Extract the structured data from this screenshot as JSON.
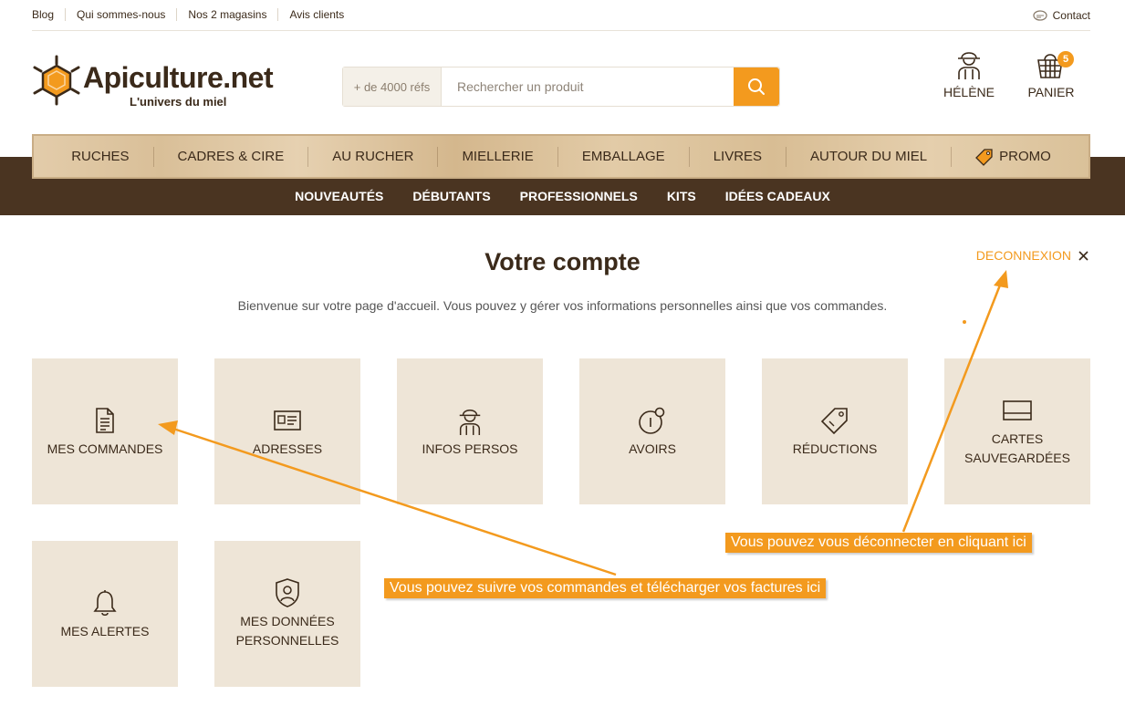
{
  "topbar": {
    "links": [
      "Blog",
      "Qui sommes-nous",
      "Nos 2 magasins",
      "Avis clients"
    ],
    "contact": "Contact"
  },
  "logo": {
    "name": "Apiculture.net",
    "tagline": "L'univers du miel"
  },
  "search": {
    "refs": "+ de 4000 réfs",
    "placeholder": "Rechercher un produit"
  },
  "account": {
    "label": "HÉLÈNE"
  },
  "cart": {
    "label": "PANIER",
    "count": "5"
  },
  "nav": {
    "items": [
      "RUCHES",
      "CADRES & CIRE",
      "AU RUCHER",
      "MIELLERIE",
      "EMBALLAGE",
      "LIVRES",
      "AUTOUR DU MIEL",
      "PROMO"
    ]
  },
  "subnav": {
    "items": [
      "NOUVEAUTÉS",
      "DÉBUTANTS",
      "PROFESSIONNELS",
      "KITS",
      "IDÉES CADEAUX"
    ]
  },
  "main": {
    "title": "Votre compte",
    "logout": "DECONNEXION",
    "welcome": "Bienvenue sur votre page d'accueil. Vous pouvez y gérer vos informations personnelles ainsi que vos commandes.",
    "tiles": [
      {
        "label": "MES COMMANDES",
        "icon": "document-icon"
      },
      {
        "label": "ADRESSES",
        "icon": "id-card-icon"
      },
      {
        "label": "INFOS PERSOS",
        "icon": "beekeeper-icon"
      },
      {
        "label": "AVOIRS",
        "icon": "credit-icon"
      },
      {
        "label": "RÉDUCTIONS",
        "icon": "tag-icon"
      },
      {
        "label": "CARTES SAUVEGARDÉES",
        "icon": "card-icon"
      },
      {
        "label": "MES ALERTES",
        "icon": "bell-icon"
      },
      {
        "label": "MES DONNÉES PERSONNELLES",
        "icon": "shield-user-icon"
      }
    ]
  },
  "annotations": {
    "logout_note": "Vous pouvez vous déconnecter en cliquant ici",
    "orders_note": "Vous pouvez suivre vos commandes et télécharger vos factures ici"
  },
  "colors": {
    "accent": "#f39a1e",
    "brown": "#4a3421",
    "tile": "#eee5d7"
  }
}
